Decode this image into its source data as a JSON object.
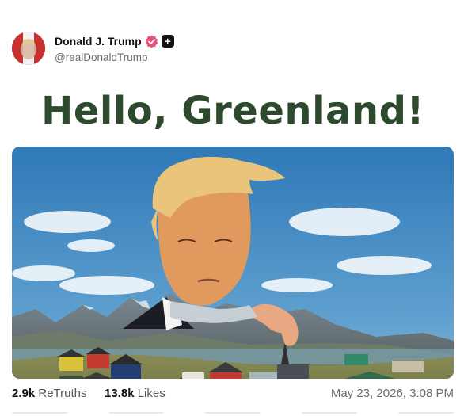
{
  "post": {
    "author": {
      "display_name": "Donald J. Trump",
      "handle": "@realDonaldTrump",
      "verified_icon": "verified-badge-icon",
      "follow_icon": "plus-icon"
    },
    "headline": "Hello, Greenland!",
    "stats": {
      "retruths_count": "2.9k",
      "retruths_label": "ReTruths",
      "likes_count": "13.8k",
      "likes_label": "Likes"
    },
    "timestamp": "May 23, 2026, 3:08 PM"
  },
  "colors": {
    "headline": "#2d4a2e",
    "verified": "#e8507a",
    "text_muted": "#6b6b76",
    "sky": "#3f86c4"
  }
}
